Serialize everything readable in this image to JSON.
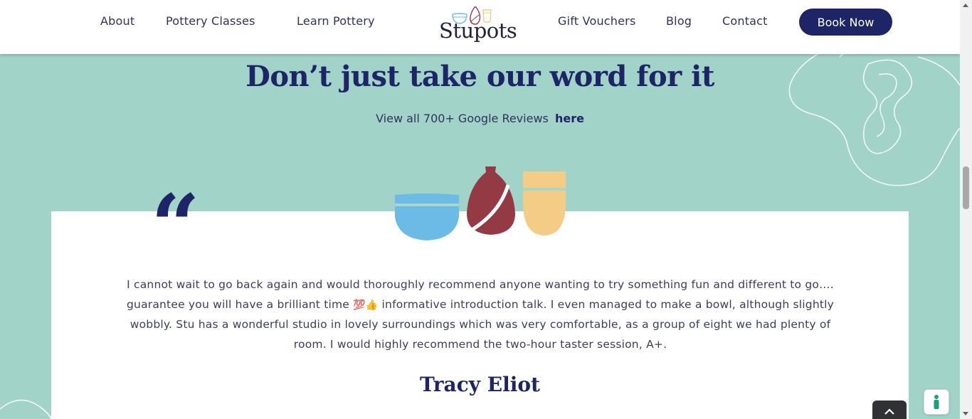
{
  "header": {
    "nav_left": [
      "About",
      "Pottery Classes",
      "Learn Pottery"
    ],
    "logo_text": "Stupots",
    "nav_right": [
      "Gift Vouchers",
      "Blog",
      "Contact"
    ],
    "book_button": "Book Now"
  },
  "testimonials": {
    "heading": "Don’t just take our word for it",
    "reviews_prefix": "View all 700+ Google Reviews",
    "reviews_link": "here",
    "quote_mark": "“",
    "review": {
      "text_part1": "I cannot wait to go back again and would thoroughly recommend anyone wanting to try something fun and different to go…. guarantee you will have a brilliant time ",
      "emoji": "💯👍",
      "text_part2": " informative introduction talk. I even managed to make a bowl, although slightly wobbly. Stu has a wonderful studio in lovely surroundings which was very comfortable, as a group of eight we had plenty of room. I would highly recommend the two-hour taster session, A+.",
      "author": "Tracy Eliot"
    }
  },
  "colors": {
    "background": "#a2d3c9",
    "navy": "#1d2566",
    "pot_blue": "#6bbbe6",
    "pot_red": "#943a45",
    "pot_yellow": "#f5cc85"
  },
  "icons": {
    "back_to_top": "chevron-up-icon",
    "cookie": "cookie-settings-icon"
  }
}
